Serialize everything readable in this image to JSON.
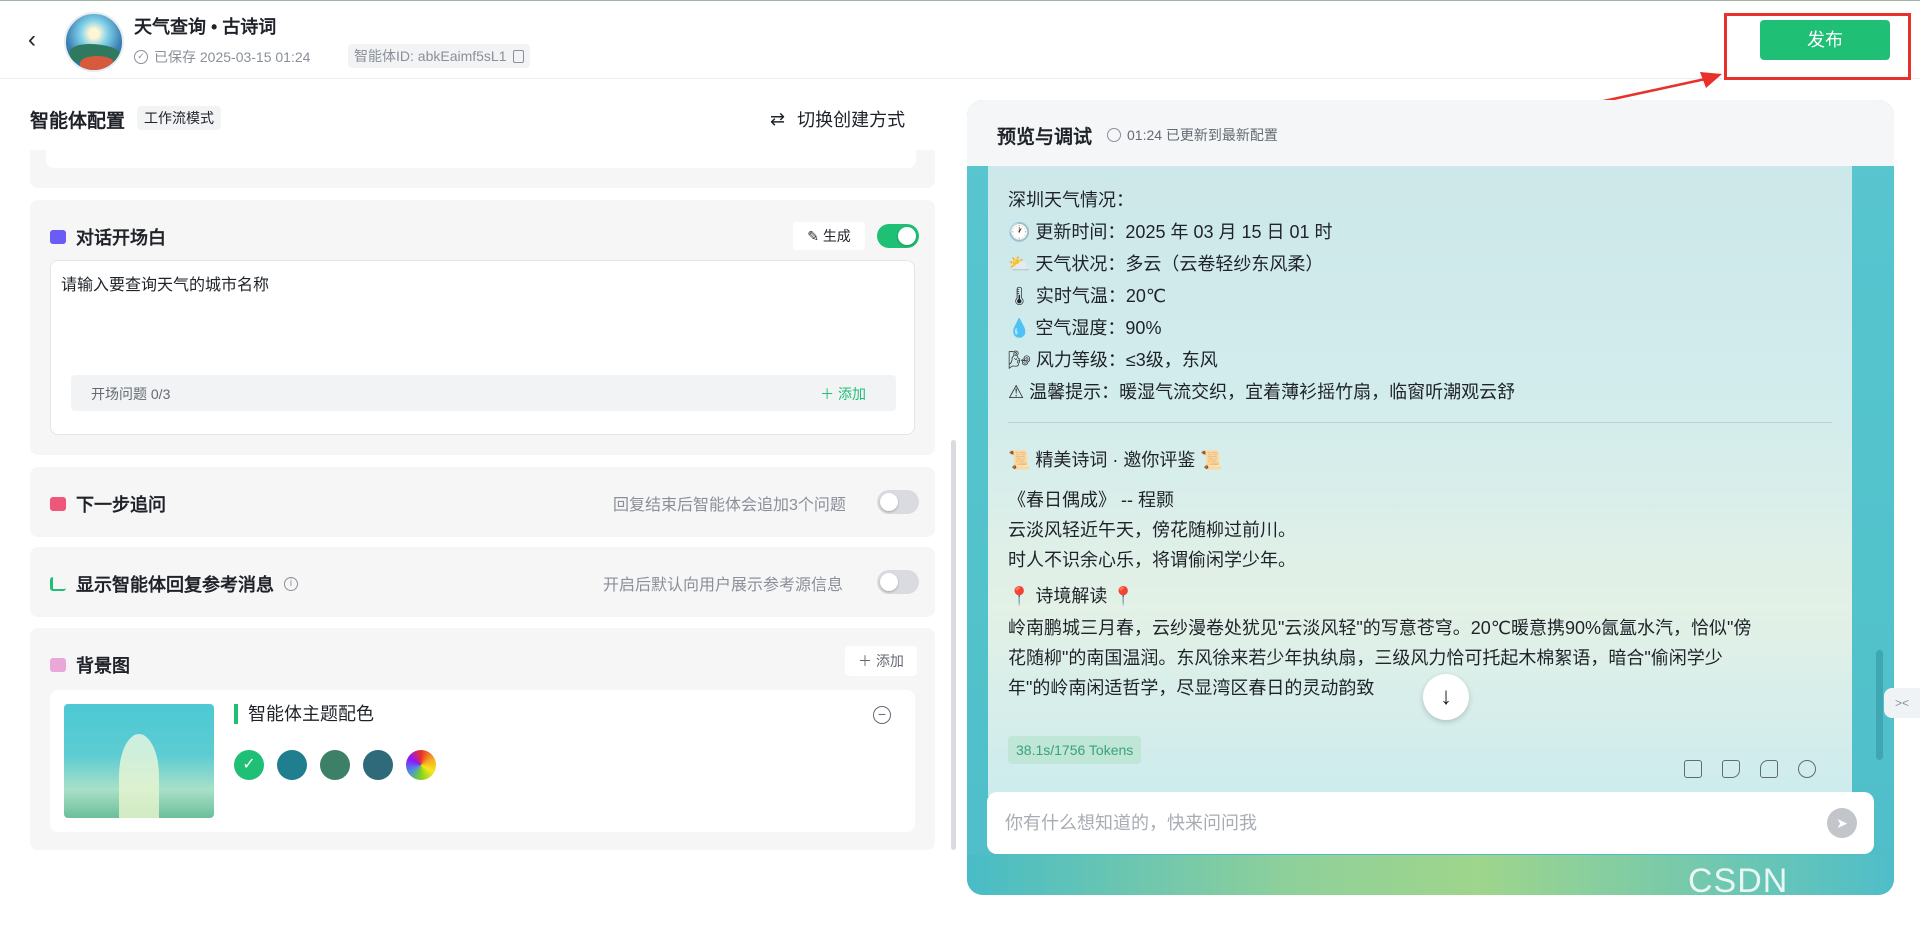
{
  "header": {
    "app_title": "天气查询 • 古诗词",
    "saved_status": "已保存 2025-03-15 01:24",
    "agent_id": "智能体ID: abkEaimf5sL1",
    "publish_label": "发布"
  },
  "config": {
    "title": "智能体配置",
    "mode_tag": "工作流模式",
    "switch_label": "切换创建方式",
    "opening": {
      "title": "对话开场白",
      "generate_label": "生成",
      "text": "请输入要查询天气的城市名称",
      "questions_count": "开场问题 0/3",
      "add_label": "添加",
      "enabled": true
    },
    "next_step": {
      "title": "下一步追问",
      "hint": "回复结束后智能体会追加3个问题",
      "enabled": false
    },
    "references": {
      "title": "显示智能体回复参考消息",
      "hint": "开启后默认向用户展示参考源信息",
      "enabled": false
    },
    "background": {
      "title": "背景图",
      "add_label": "添加",
      "theme_label": "智能体主题配色",
      "swatches": [
        "#1fbf75",
        "#1f7f8f",
        "#3c8068",
        "#2e6a7a",
        "conic"
      ]
    }
  },
  "preview": {
    "title": "预览与调试",
    "status": "01:24 已更新到最新配置",
    "lines": [
      "深圳天气情况：",
      "更新时间：2025 年 03 月 15 日 01 时",
      "天气状况：多云（云卷轻纱东风柔）",
      "实时气温：20℃",
      "空气湿度：90%",
      "风力等级：≤3级，东风",
      "温馨提示：暖湿气流交织，宜着薄衫摇竹扇，临窗听潮观云舒"
    ],
    "poem_header": "精美诗词 · 邀你评鉴",
    "poem_title": "《春日偶成》 -- 程颢",
    "poem_line1": "云淡风轻近午天，傍花随柳过前川。",
    "poem_line2": "时人不识余心乐，将谓偷闲学少年。",
    "interp_header": "诗境解读",
    "interp_lines": [
      "岭南鹏城三月春，云纱漫卷处犹见\"云淡风轻\"的写意苍穹。20℃暖意携90%氤氲水汽，恰似\"傍",
      "花随柳\"的南国温润。东风徐来若少年执纨扇，三级风力恰可托起木棉絮语，暗合\"偷闲学少",
      "年\"的岭南闲适哲学，尽显湾区春日的灵动韵致"
    ],
    "tokens": "38.1s/1756 Tokens",
    "input_placeholder": "你有什么想知道的，快来问问我"
  },
  "watermark": "CSDN @kocor"
}
